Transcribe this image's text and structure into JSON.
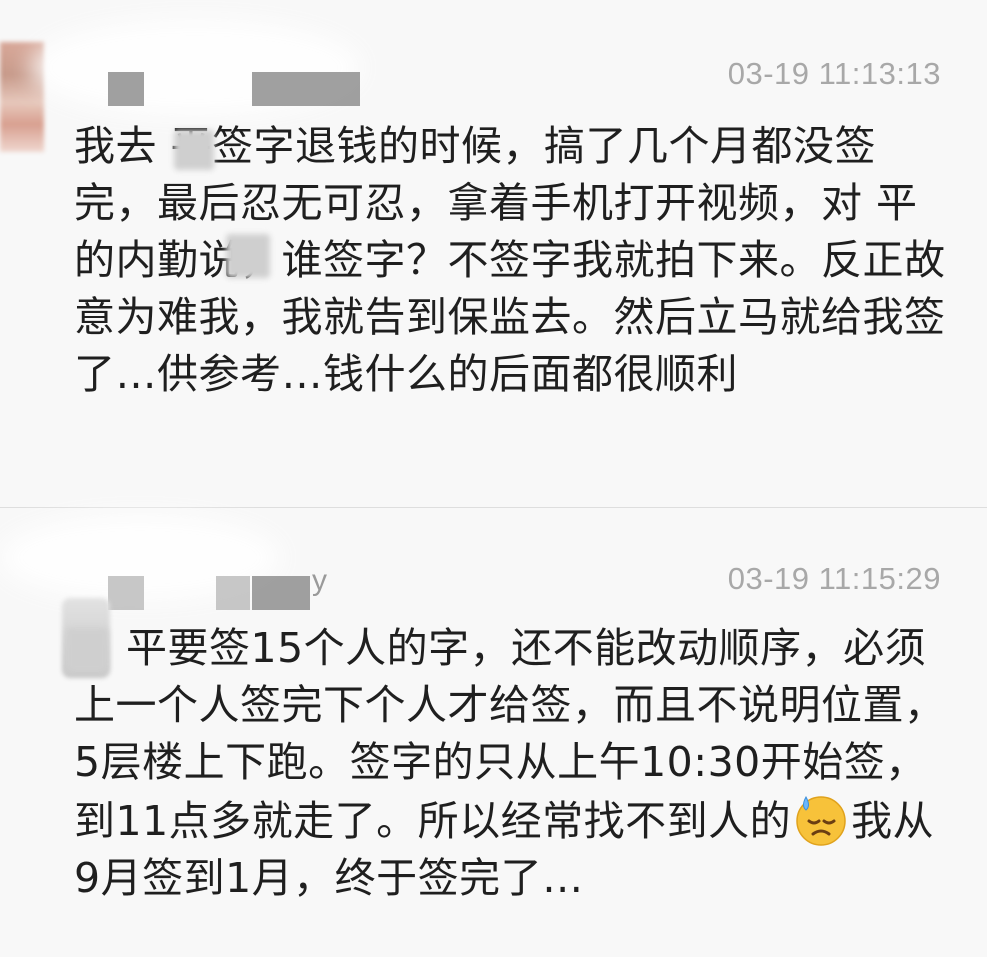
{
  "comments": [
    {
      "author_visible": "",
      "timestamp": "03-19 11:13:13",
      "text": "我去 平签字退钱的时候，搞了几个月都没签完，最后忍无可忍，拿着手机打开视频，对 平的内勤说，谁签字？不签字我就拍下来。反正故意为难我，我就告到保监去。然后立马就给我签了…供参考…钱什么的后面都很顺利"
    },
    {
      "author_visible": "y",
      "timestamp": "03-19 11:15:29",
      "text_before_emoji": "平要签15个人的字，还不能改动顺序，必须上一个人签完下个人才给签，而且不说明位置，5层楼上下跑。签字的只从上午10:30开始签，到11点多就走了。所以经常找不到人的",
      "emoji": "sweat-face-emoji",
      "text_after_emoji": "我从9月签到1月，终于签完了…"
    }
  ]
}
